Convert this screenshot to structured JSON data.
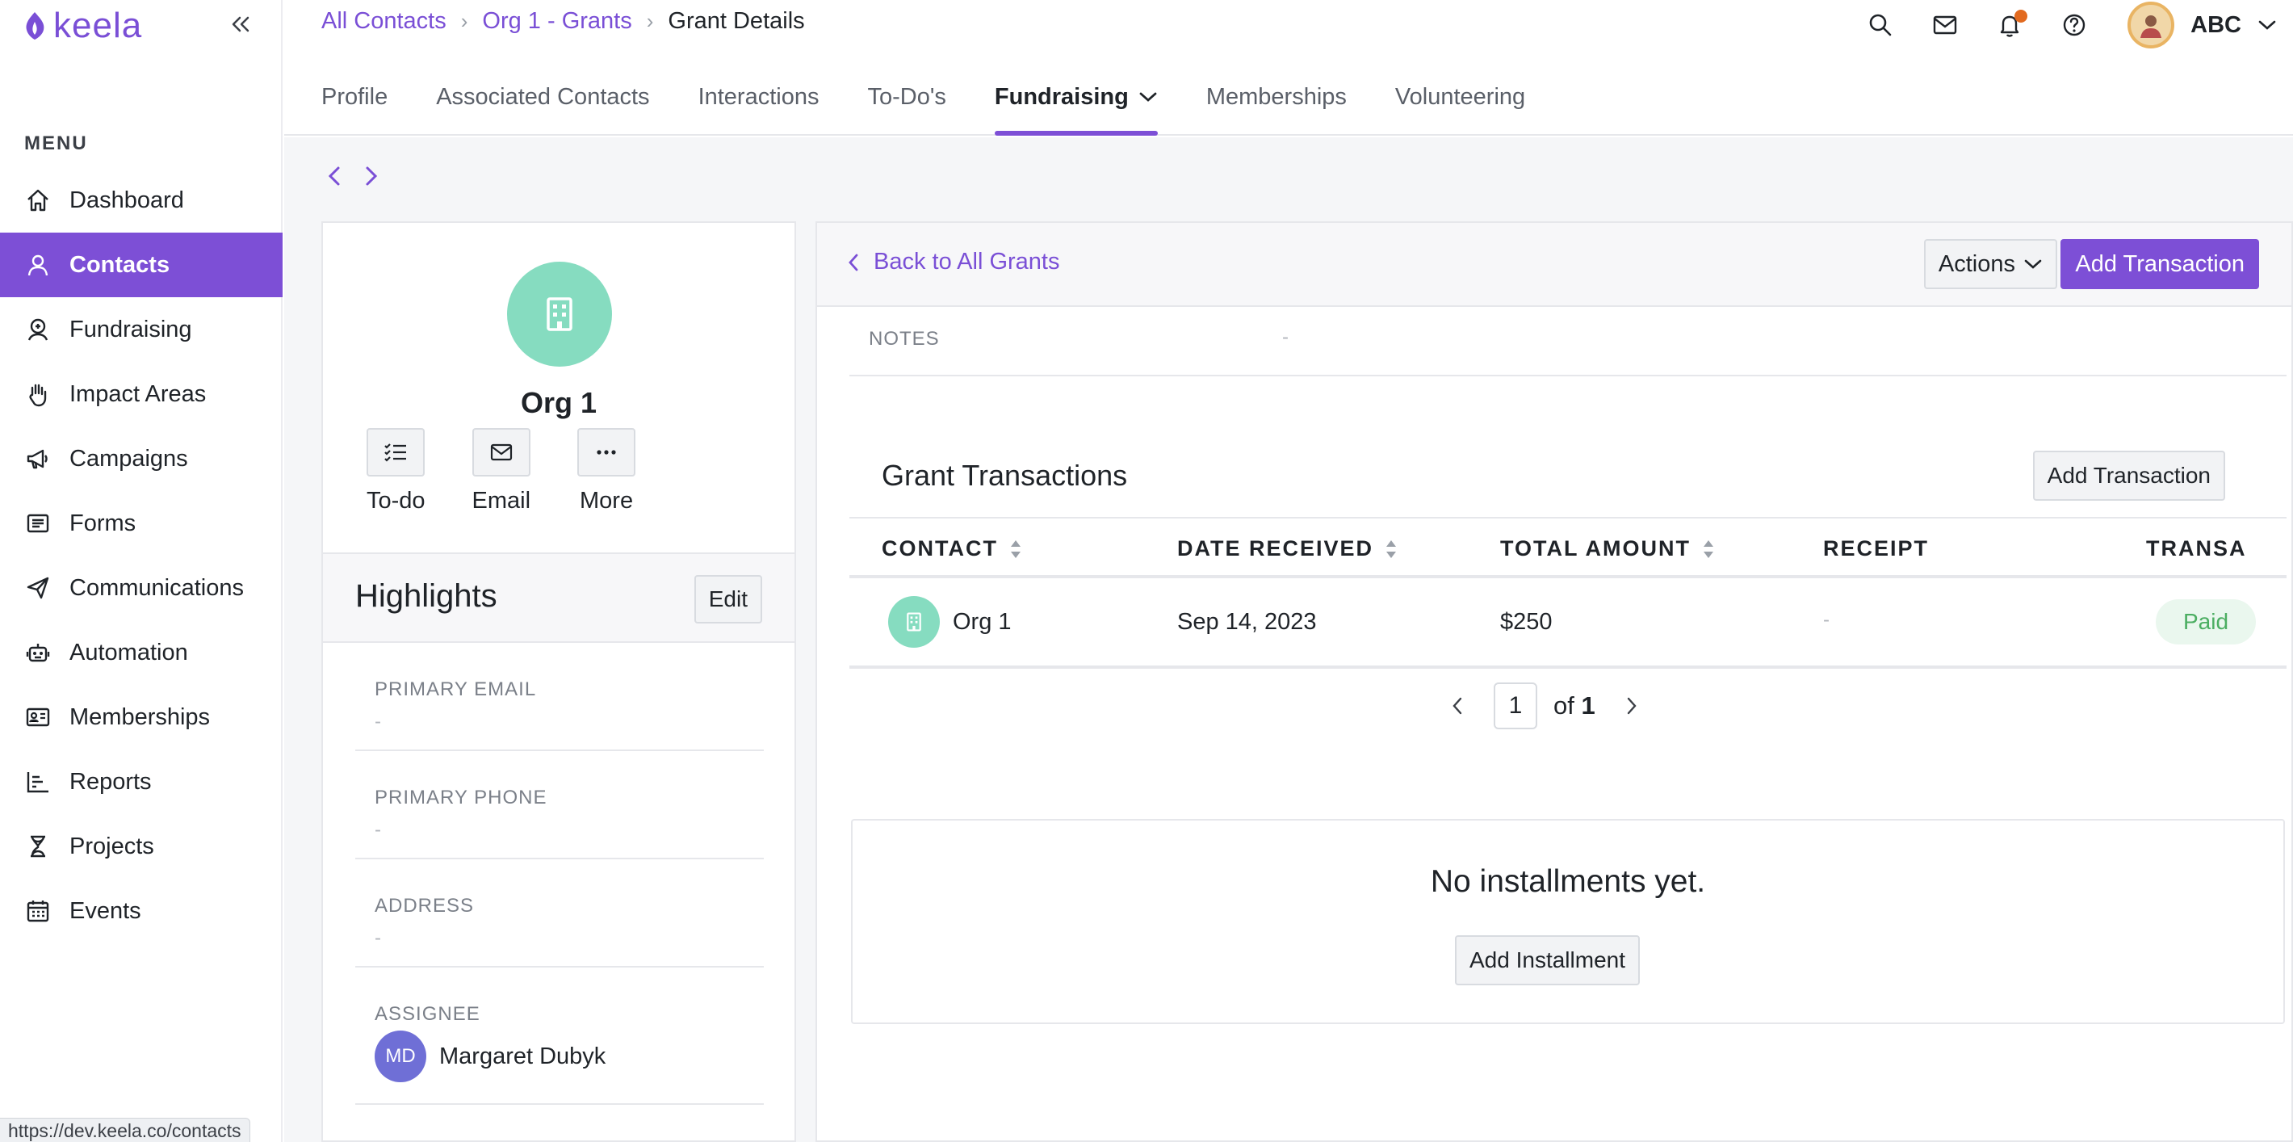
{
  "app": {
    "logo_text": "keela"
  },
  "colors": {
    "accent": "#7d4fd6",
    "org_avatar": "#86dcc0",
    "paid_bg": "#eaf7ee",
    "paid_text": "#4cae62",
    "notification_dot": "#e26a1f"
  },
  "sidebar": {
    "menu_label": "MENU",
    "items": [
      {
        "label": "Dashboard",
        "icon": "home-icon"
      },
      {
        "label": "Contacts",
        "icon": "user-icon",
        "active": true
      },
      {
        "label": "Fundraising",
        "icon": "donor-icon"
      },
      {
        "label": "Impact Areas",
        "icon": "hand-icon"
      },
      {
        "label": "Campaigns",
        "icon": "megaphone-icon"
      },
      {
        "label": "Forms",
        "icon": "form-icon"
      },
      {
        "label": "Communications",
        "icon": "send-icon"
      },
      {
        "label": "Automation",
        "icon": "robot-icon"
      },
      {
        "label": "Memberships",
        "icon": "id-card-icon"
      },
      {
        "label": "Reports",
        "icon": "chart-icon"
      },
      {
        "label": "Projects",
        "icon": "hourglass-icon"
      },
      {
        "label": "Events",
        "icon": "calendar-icon"
      }
    ]
  },
  "status_bar_url": "https://dev.keela.co/contacts",
  "breadcrumb": {
    "items": [
      "All Contacts",
      "Org 1 - Grants"
    ],
    "current": "Grant Details"
  },
  "user": {
    "name": "ABC"
  },
  "tabs": [
    {
      "label": "Profile"
    },
    {
      "label": "Associated Contacts"
    },
    {
      "label": "Interactions"
    },
    {
      "label": "To-Do's"
    },
    {
      "label": "Fundraising",
      "active": true
    },
    {
      "label": "Memberships"
    },
    {
      "label": "Volunteering"
    }
  ],
  "profile": {
    "name": "Org 1",
    "actions": [
      {
        "label": "To-do"
      },
      {
        "label": "Email"
      },
      {
        "label": "More"
      }
    ],
    "highlights_title": "Highlights",
    "edit_label": "Edit",
    "fields": [
      {
        "label": "PRIMARY EMAIL",
        "value": "-"
      },
      {
        "label": "PRIMARY PHONE",
        "value": "-"
      },
      {
        "label": "ADDRESS",
        "value": "-"
      }
    ],
    "assignee": {
      "label": "ASSIGNEE",
      "initials": "MD",
      "name": "Margaret Dubyk"
    }
  },
  "detail": {
    "back_label": "Back to All Grants",
    "actions_label": "Actions",
    "add_transaction_label": "Add Transaction",
    "notes": {
      "label": "NOTES",
      "value": "-"
    },
    "grant_transactions": {
      "title": "Grant Transactions",
      "add_label": "Add Transaction",
      "columns": [
        "CONTACT",
        "DATE RECEIVED",
        "TOTAL AMOUNT",
        "RECEIPT",
        "TRANSA"
      ],
      "rows": [
        {
          "contact": "Org 1",
          "date_received": "Sep 14, 2023",
          "total_amount": "$250",
          "receipt": "-",
          "status": "Paid"
        }
      ]
    },
    "pagination": {
      "page": "1",
      "of_label": "of",
      "total": "1"
    },
    "installments": {
      "empty_text": "No installments yet.",
      "add_label": "Add Installment"
    }
  }
}
